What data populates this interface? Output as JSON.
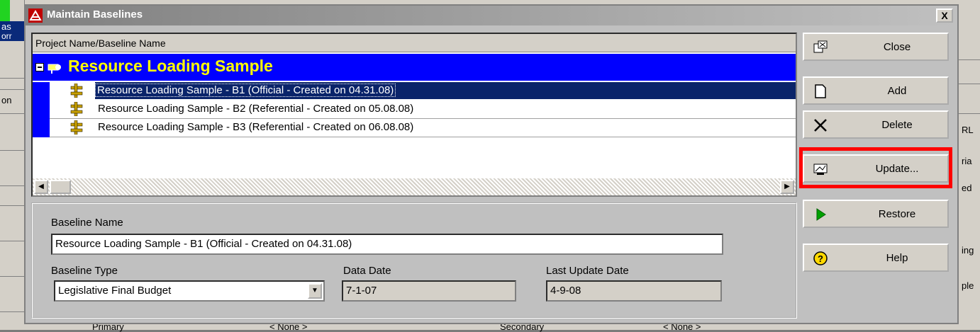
{
  "window": {
    "title": "Maintain Baselines",
    "close_glyph": "X"
  },
  "tree": {
    "column_header": "Project Name/Baseline Name",
    "project_name": "Resource Loading Sample",
    "baselines": [
      {
        "label": "Resource Loading Sample - B1 (Official - Created on 04.31.08)",
        "selected": true
      },
      {
        "label": "Resource Loading Sample - B2 (Referential - Created on 05.08.08)",
        "selected": false
      },
      {
        "label": "Resource Loading Sample - B3 (Referential - Created on 06.08.08)",
        "selected": false
      }
    ]
  },
  "details": {
    "baseline_name_label": "Baseline Name",
    "baseline_name_value": "Resource Loading Sample - B1 (Official - Created on 04.31.08)",
    "baseline_type_label": "Baseline Type",
    "baseline_type_value": "Legislative Final Budget",
    "data_date_label": "Data Date",
    "data_date_value": "7-1-07",
    "last_update_label": "Last Update Date",
    "last_update_value": "4-9-08"
  },
  "buttons": {
    "close": "Close",
    "add": "Add",
    "delete": "Delete",
    "update": "Update...",
    "restore": "Restore",
    "help": "Help"
  },
  "background": {
    "left_texts": [
      "as",
      "orr",
      "on"
    ],
    "right_texts": [
      "RL",
      "ria",
      "ed",
      "ing",
      "ple"
    ],
    "bottom_texts": [
      "Primary",
      "< None >",
      "Secondary",
      "< None >"
    ]
  },
  "colors": {
    "project_row": "#0000ff",
    "project_text": "#ffff00",
    "selection": "#0a246a",
    "highlight_box": "#ff0000"
  }
}
